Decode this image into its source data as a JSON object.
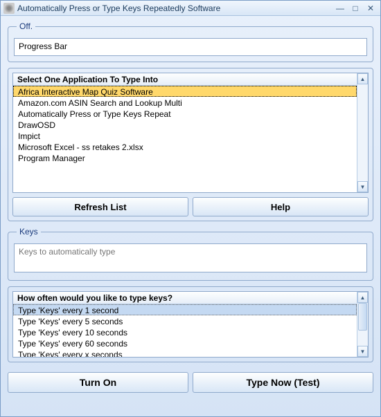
{
  "window": {
    "title": "Automatically Press or Type Keys Repeatedly Software"
  },
  "off_group": {
    "legend": "Off.",
    "progress_label": "Progress Bar"
  },
  "app_list": {
    "header": "Select One Application To Type Into",
    "items": [
      "Africa Interactive Map Quiz Software",
      "Amazon.com ASIN Search and Lookup Multi",
      "Automatically Press or Type Keys Repeat",
      "DrawOSD",
      "Impict",
      "Microsoft Excel - ss retakes 2.xlsx",
      "Program Manager"
    ],
    "selected_index": 0
  },
  "buttons": {
    "refresh": "Refresh List",
    "help": "Help",
    "turn_on": "Turn On",
    "type_now": "Type Now (Test)"
  },
  "keys_group": {
    "legend": "Keys",
    "placeholder": "Keys to automatically type"
  },
  "freq_list": {
    "header": "How often would you like to type keys?",
    "items": [
      "Type 'Keys' every 1 second",
      "Type 'Keys' every 5 seconds",
      "Type 'Keys' every 10 seconds",
      "Type 'Keys' every 60 seconds",
      "Type 'Keys' every x seconds"
    ],
    "selected_index": 0
  }
}
